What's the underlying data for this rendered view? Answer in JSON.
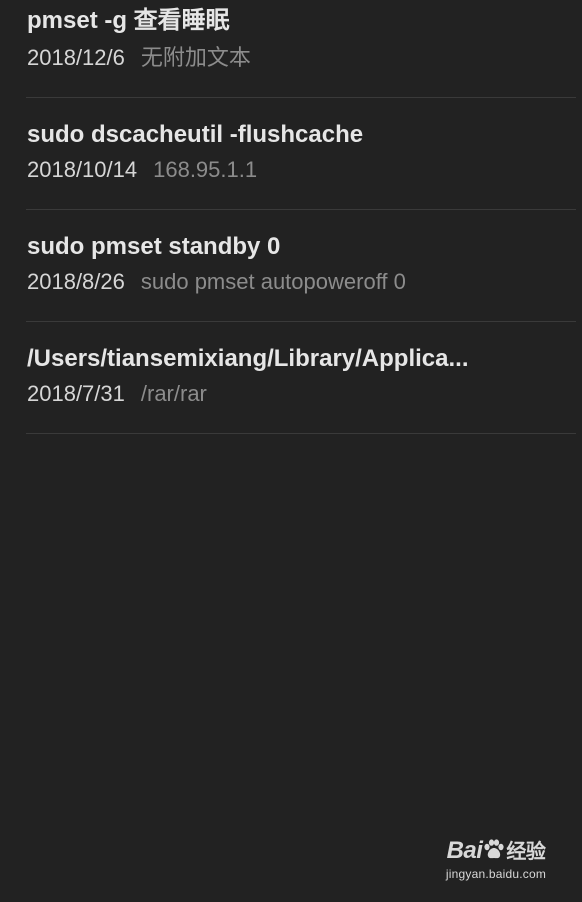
{
  "notes": [
    {
      "title": "pmset -g 查看睡眠",
      "date": "2018/12/6",
      "preview": "无附加文本"
    },
    {
      "title": "sudo dscacheutil -flushcache",
      "date": "2018/10/14",
      "preview": "168.95.1.1"
    },
    {
      "title": "sudo pmset standby 0",
      "date": "2018/8/26",
      "preview": "sudo pmset autopoweroff 0"
    },
    {
      "title": "/Users/tiansemixiang/Library/Applica...",
      "date": "2018/7/31",
      "preview": "/rar/rar"
    }
  ],
  "watermark": {
    "brand_left": "Bai",
    "brand_right": "经验",
    "url": "jingyan.baidu.com"
  },
  "colors": {
    "background": "#222222",
    "title": "#e6e6e6",
    "date": "#d6d6d6",
    "preview": "#8c8c8c",
    "divider": "#3a3a3a"
  }
}
